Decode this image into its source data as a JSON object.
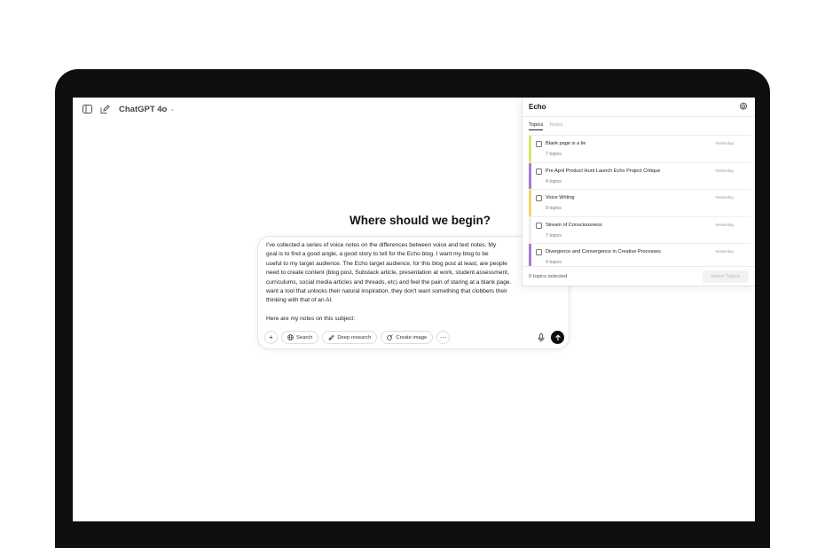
{
  "topbar": {
    "model_name": "ChatGPT 4o",
    "sidebar_icon": "sidebar-toggle-icon",
    "new_chat_icon": "compose-icon"
  },
  "hero": {
    "title": "Where should we begin?"
  },
  "composer": {
    "text": "I've collected a series of voice notes on the differences between voice and text notes. My\ngoal is to find a good angle, a good story to tell for the Echo blog. I want my blog to be\nuseful to my target audience. The Echo target audience, for this blog post at least, are people\nneed to create content (blog post, Substack article, presentation at work, student assessment,\ncurriculums, social media articles and threads, etc) and feel the pain of staring at a blank page.\nwant a tool that unlocks their natural inspiration, they don't want something that clobbers their\nthinking with that of an AI.\n\nHere are my notes on this subject:",
    "tools": {
      "add": "+",
      "search": "Search",
      "deep_research": "Deep research",
      "create_image": "Create image",
      "more": "···"
    }
  },
  "echo": {
    "title": "Echo",
    "tabs": [
      "Topics",
      "Notes"
    ],
    "items": [
      {
        "title": "Blank page is a lie",
        "subtitle": "7 topics",
        "date": "Yesterday",
        "color": "#d6e86a"
      },
      {
        "title": "Pre April Product Hunt Launch Echo Project Critique",
        "subtitle": "4 topics",
        "date": "Yesterday",
        "color": "#a77bd3"
      },
      {
        "title": "Voice Writing",
        "subtitle": "9 topics",
        "date": "Yesterday",
        "color": "#f4d36b"
      },
      {
        "title": "Stream of Consciousness",
        "subtitle": "7 topics",
        "date": "Yesterday",
        "color": "#eeeeee"
      },
      {
        "title": "Divergence and Convergence in Creative Processes",
        "subtitle": "4 topics",
        "date": "Yesterday",
        "color": "#a77bd3"
      }
    ],
    "selected_count": "0 topics selected",
    "insert_label": "Insert Topics"
  }
}
